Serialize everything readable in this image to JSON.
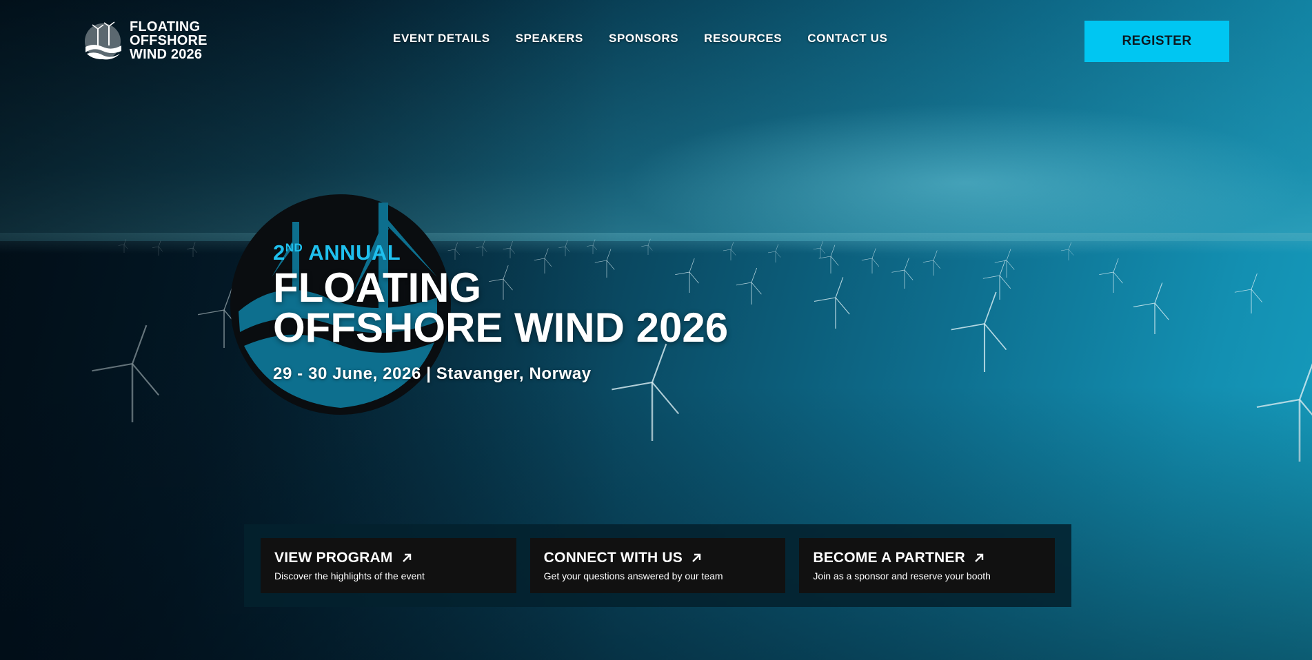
{
  "header": {
    "logo_lines": [
      "FLOATING",
      "OFFSHORE",
      "WIND 2026"
    ],
    "nav": [
      {
        "label": "EVENT DETAILS"
      },
      {
        "label": "SPEAKERS"
      },
      {
        "label": "SPONSORS"
      },
      {
        "label": "RESOURCES"
      },
      {
        "label": "CONTACT US"
      }
    ],
    "register_label": "REGISTER"
  },
  "hero": {
    "annual_number": "2",
    "annual_suffix": "ND",
    "annual_word": "ANNUAL",
    "title_line1": "FLOATING",
    "title_line2": "OFFSHORE WIND 2026",
    "date_location": "29 - 30 June, 2026 | Stavanger, Norway"
  },
  "cta": [
    {
      "title": "VIEW PROGRAM",
      "desc": "Discover the highlights of the event"
    },
    {
      "title": "CONNECT WITH US",
      "desc": "Get your questions answered by our team"
    },
    {
      "title": "BECOME A PARTNER",
      "desc": "Join as a sponsor and reserve your booth"
    }
  ],
  "colors": {
    "accent": "#00c6f2",
    "annual_text": "#1fc0ee",
    "card_bg": "#111111",
    "panel_bg": "#03212d"
  },
  "icons": {
    "logo": "turbine-wave-logo-icon",
    "cta_arrow": "arrow-up-right-icon",
    "hero_badge": "turbine-wave-badge-icon"
  }
}
